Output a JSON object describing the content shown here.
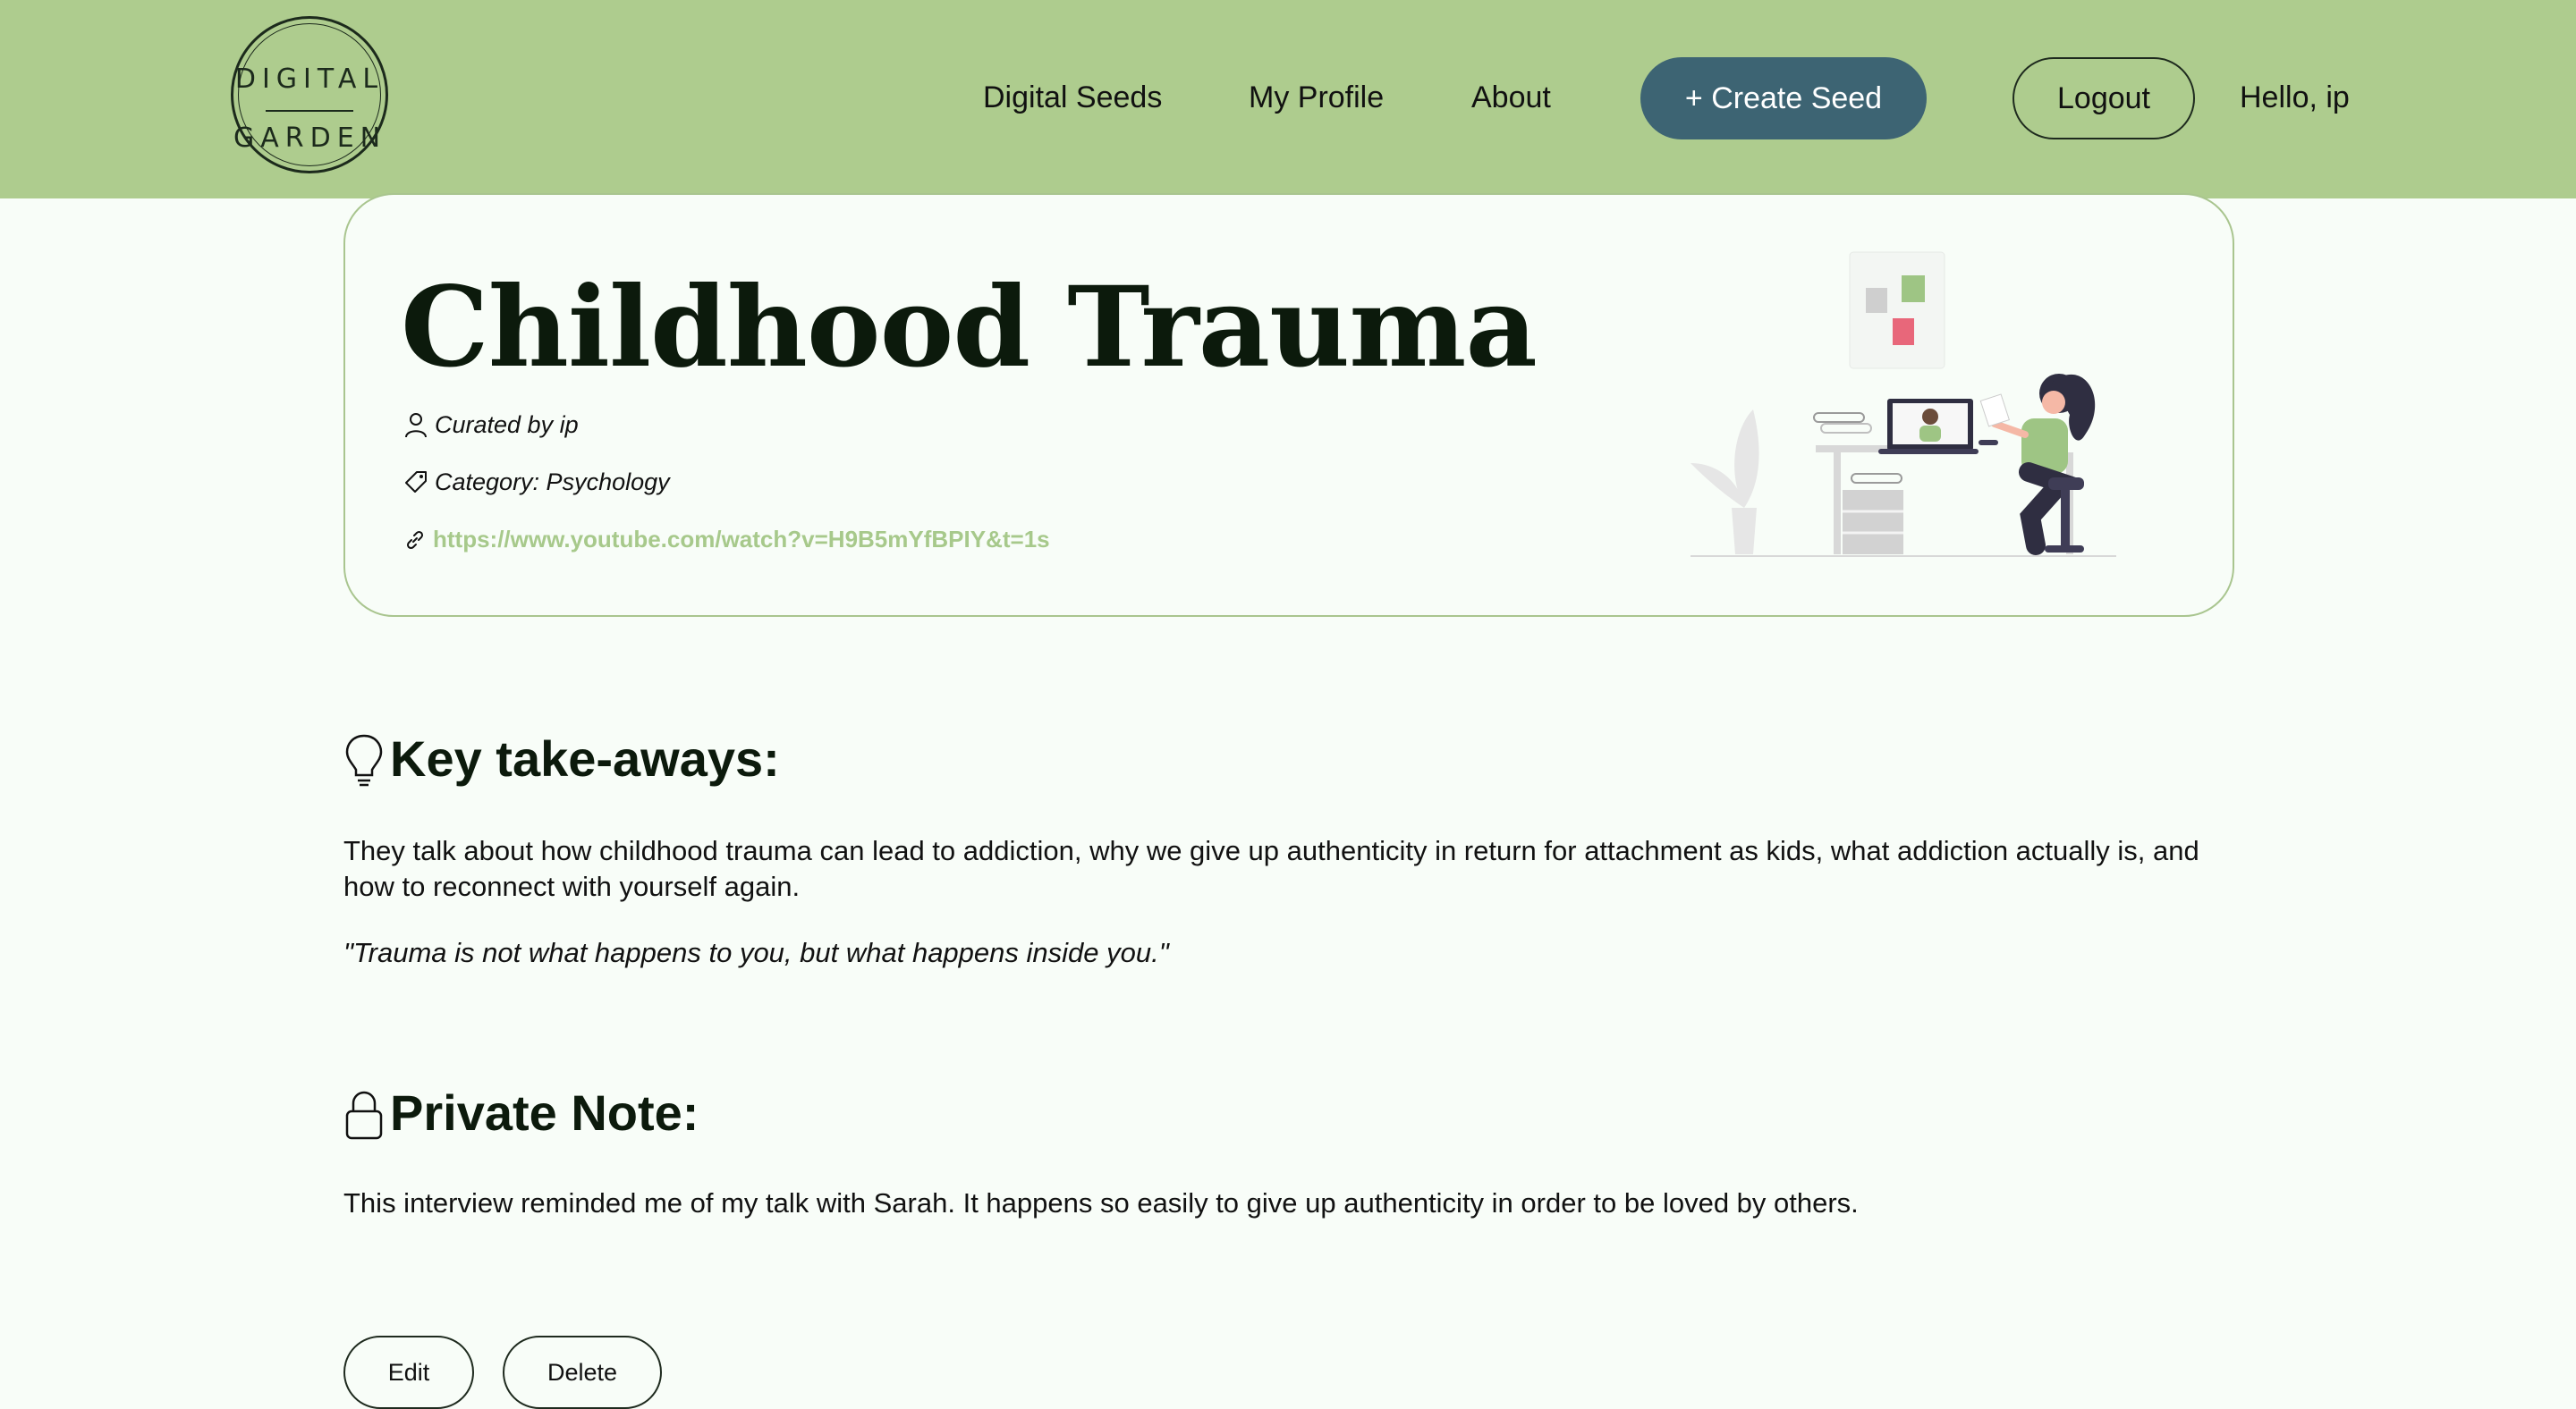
{
  "header": {
    "logo": {
      "line1": "DIGITAL",
      "line2": "GARDEN"
    },
    "nav": [
      {
        "label": "Digital Seeds"
      },
      {
        "label": "My Profile"
      },
      {
        "label": "About"
      }
    ],
    "create_button": "+ Create Seed",
    "logout_button": "Logout",
    "greeting": "Hello, ip"
  },
  "seed": {
    "title": "Childhood Trauma",
    "curated_by": "Curated by ip",
    "category": "Category: Psychology",
    "url": "https://www.youtube.com/watch?v=H9B5mYfBPIY&t=1s"
  },
  "takeaways": {
    "heading": "Key take-aways:",
    "text": "They talk about how childhood trauma can lead to addiction, why we give up authenticity in return for attachment as kids, what addiction actually is, and how to reconnect with yourself again.",
    "quote": "\"Trauma is not what happens to you, but what happens inside you.\""
  },
  "private_note": {
    "heading": "Private Note:",
    "text": "This interview reminded me of my talk with Sarah. It happens so easily to give up authenticity in order to be loved by others."
  },
  "actions": {
    "edit": "Edit",
    "delete": "Delete"
  },
  "colors": {
    "header_bg": "#aecc8e",
    "primary_button": "#3d6473",
    "link": "#a7c98b",
    "page_bg": "#f8fdf8"
  }
}
